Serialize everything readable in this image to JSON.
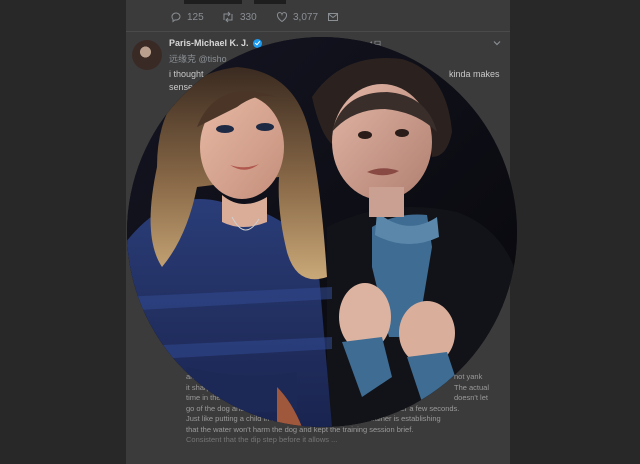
{
  "tweet_prev": {
    "replies": "125",
    "retweets": "330",
    "likes": "3,077"
  },
  "tweet": {
    "author_name": "Paris-Michael K. J.",
    "handle": "@tisho",
    "handle_prefix": "远缘克",
    "date_fragment": "4日",
    "text_left": "i thought",
    "text_right": "kinda makes",
    "text_line2": "sense",
    "body_lines": [
      {
        "left": "and",
        "right": "not yank"
      },
      {
        "left": "it sharp",
        "right": "The actual"
      },
      {
        "left": "time in the",
        "right": "doesn't let"
      },
      {
        "left": "go of the dog and",
        "right": "gain after a few seconds."
      },
      {
        "left": "Just like putting a child in the bath tub for a little bit, the trainer is establishing",
        "right": ""
      },
      {
        "left": "that the water won't harm the dog and kept the training session brief.",
        "right": ""
      },
      {
        "left": "Consistent that the dip step before it allows ...",
        "right": ""
      }
    ]
  },
  "photo": {
    "shape": "circle"
  },
  "colors": {
    "background": "#282828",
    "timeline": "#3b3b3b",
    "verified": "#1d9bf0"
  },
  "icons": {
    "reply": "reply-icon",
    "retweet": "retweet-icon",
    "like": "like-icon",
    "message": "message-icon",
    "caret": "chevron-down-icon",
    "verified": "verified-badge-icon"
  }
}
